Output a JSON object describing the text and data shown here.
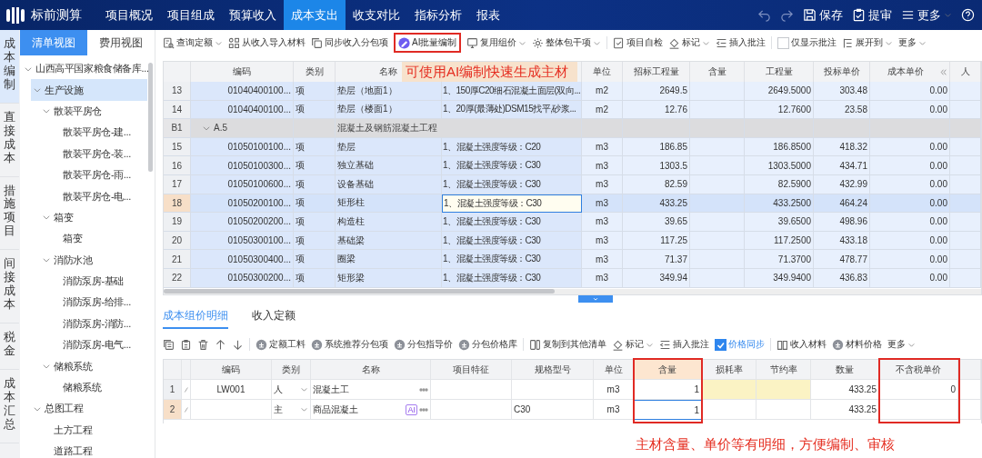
{
  "app": {
    "title": "标前测算"
  },
  "nav": {
    "tabs": [
      {
        "label": "项目概况",
        "selected": false
      },
      {
        "label": "项目组成",
        "selected": false
      },
      {
        "label": "预算收入",
        "selected": false
      },
      {
        "label": "成本支出",
        "selected": true
      },
      {
        "label": "收支对比",
        "selected": false
      },
      {
        "label": "指标分析",
        "selected": false
      },
      {
        "label": "报表",
        "selected": false
      }
    ],
    "actions": [
      {
        "label": "保存"
      },
      {
        "label": "提审"
      },
      {
        "label": "更多"
      }
    ]
  },
  "side_tabs": [
    {
      "label": "成本编制",
      "selected": true
    },
    {
      "label": "直接成本",
      "selected": false
    },
    {
      "label": "措施项目",
      "selected": false
    },
    {
      "label": "间接成本",
      "selected": false
    },
    {
      "label": "税金",
      "selected": false
    },
    {
      "label": "成本汇总",
      "selected": false
    }
  ],
  "view_tabs": [
    {
      "label": "清单视图",
      "selected": true
    },
    {
      "label": "费用视图",
      "selected": false
    }
  ],
  "tree": {
    "items": [
      {
        "label": "山西高平国家粮食储备库...",
        "selected": false,
        "expanded": true,
        "children": [
          {
            "label": "生产设施",
            "selected": true,
            "expanded": true,
            "children": [
              {
                "label": "散装平房仓",
                "selected": false,
                "expanded": true,
                "children": [
                  {
                    "label": "散装平房仓-建...",
                    "selected": false
                  },
                  {
                    "label": "散装平房仓-装...",
                    "selected": false
                  },
                  {
                    "label": "散装平房仓-雨...",
                    "selected": false
                  },
                  {
                    "label": "散装平房仓-电...",
                    "selected": false
                  }
                ]
              },
              {
                "label": "箱变",
                "selected": false,
                "expanded": true,
                "children": [
                  {
                    "label": "箱变",
                    "selected": false
                  }
                ]
              },
              {
                "label": "消防水池",
                "selected": false,
                "expanded": true,
                "children": [
                  {
                    "label": "消防泵房-基础",
                    "selected": false
                  },
                  {
                    "label": "消防泵房-给排...",
                    "selected": false
                  },
                  {
                    "label": "消防泵房-消防...",
                    "selected": false
                  },
                  {
                    "label": "消防泵房-电气...",
                    "selected": false
                  }
                ]
              },
              {
                "label": "储粮系统",
                "selected": false,
                "expanded": true,
                "children": [
                  {
                    "label": "储粮系统",
                    "selected": false
                  }
                ]
              }
            ]
          },
          {
            "label": "总图工程",
            "selected": false,
            "expanded": true,
            "children": [
              {
                "label": "土方工程",
                "selected": false
              },
              {
                "label": "道路工程",
                "selected": false
              }
            ]
          }
        ]
      }
    ]
  },
  "toolbar": {
    "groups": [
      [
        {
          "label": "查询定额",
          "kind": "dropdown"
        },
        {
          "label": "从收入导入材料",
          "kind": "button"
        },
        {
          "label": "同步收入分包项",
          "kind": "button"
        },
        {
          "label": "AI批量编制",
          "kind": "button"
        },
        {
          "label": "复用组价",
          "kind": "dropdown"
        },
        {
          "label": "整体包干项",
          "kind": "dropdown"
        }
      ],
      [
        {
          "label": "项目自检",
          "kind": "button"
        },
        {
          "label": "标记",
          "kind": "dropdown"
        },
        {
          "label": "插入批注",
          "kind": "button"
        }
      ],
      [
        {
          "label": "仅显示批注",
          "kind": "checkbox",
          "checked": false
        },
        {
          "label": "展开到",
          "kind": "dropdown"
        },
        {
          "label": "更多",
          "kind": "dropdown"
        }
      ]
    ]
  },
  "grid": {
    "columns": [
      {
        "label": "编码"
      },
      {
        "label": "类别"
      },
      {
        "label": "名称"
      },
      {},
      {
        "label": "单位"
      },
      {
        "label": "招标工程量"
      },
      {
        "label": "含量"
      },
      {
        "label": "工程量"
      },
      {
        "label": "投标单价"
      },
      {
        "label": "成本单价"
      },
      {
        "label": "人"
      }
    ],
    "annotation": "可使用AI编制快速生成主材",
    "rows": [
      {
        "kind": "item",
        "num": "13",
        "code": "01040400100...",
        "type": "项",
        "name": "垫层（地面1）",
        "feature": "1、150厚C20细石混凝土面层(双向...",
        "unit": "m2",
        "bid_qty": "2649.5",
        "qty": "2649.5000",
        "bid_price": "303.48",
        "cost_price": "0.00",
        "selected": false
      },
      {
        "kind": "item",
        "num": "14",
        "code": "01040400100...",
        "type": "项",
        "name": "垫层（楼面1）",
        "feature": "1、20厚(最薄处)DSM15找平,砂浆...",
        "unit": "m2",
        "bid_qty": "12.76",
        "qty": "12.7600",
        "bid_price": "23.58",
        "cost_price": "0.00",
        "selected": false
      },
      {
        "kind": "group",
        "num": "B1",
        "code": "A.5",
        "name": "混凝土及钢筋混凝土工程",
        "expanded": true
      },
      {
        "kind": "item",
        "num": "15",
        "code": "01050100100...",
        "type": "项",
        "name": "垫层",
        "feature": "1、混凝土强度等级：C20",
        "unit": "m3",
        "bid_qty": "186.85",
        "qty": "186.8500",
        "bid_price": "418.32",
        "cost_price": "0.00",
        "selected": false
      },
      {
        "kind": "item",
        "num": "16",
        "code": "01050100300...",
        "type": "项",
        "name": "独立基础",
        "feature": "1、混凝土强度等级：C30",
        "unit": "m3",
        "bid_qty": "1303.5",
        "qty": "1303.5000",
        "bid_price": "434.71",
        "cost_price": "0.00",
        "selected": false
      },
      {
        "kind": "item",
        "num": "17",
        "code": "01050100600...",
        "type": "项",
        "name": "设备基础",
        "feature": "1、混凝土强度等级：C30",
        "unit": "m3",
        "bid_qty": "82.59",
        "qty": "82.5900",
        "bid_price": "432.99",
        "cost_price": "0.00",
        "selected": false
      },
      {
        "kind": "item",
        "num": "18",
        "code": "01050200100...",
        "type": "项",
        "name": "矩形柱",
        "feature": "1、混凝土强度等级：C30",
        "unit": "m3",
        "bid_qty": "433.25",
        "qty": "433.2500",
        "bid_price": "464.24",
        "cost_price": "0.00",
        "selected": true
      },
      {
        "kind": "item",
        "num": "19",
        "code": "01050200200...",
        "type": "项",
        "name": "构造柱",
        "feature": "1、混凝土强度等级：C30",
        "unit": "m3",
        "bid_qty": "39.65",
        "qty": "39.6500",
        "bid_price": "498.96",
        "cost_price": "0.00",
        "selected": false
      },
      {
        "kind": "item",
        "num": "20",
        "code": "01050300100...",
        "type": "项",
        "name": "基础梁",
        "feature": "1、混凝土强度等级：C30",
        "unit": "m3",
        "bid_qty": "117.25",
        "qty": "117.2500",
        "bid_price": "433.18",
        "cost_price": "0.00",
        "selected": false
      },
      {
        "kind": "item",
        "num": "21",
        "code": "01050300400...",
        "type": "项",
        "name": "圈梁",
        "feature": "1、混凝土强度等级：C30",
        "unit": "m3",
        "bid_qty": "71.37",
        "qty": "71.3700",
        "bid_price": "478.77",
        "cost_price": "0.00",
        "selected": false
      },
      {
        "kind": "item",
        "num": "22",
        "code": "01050300200...",
        "type": "项",
        "name": "矩形梁",
        "feature": "1、混凝土强度等级：C30",
        "unit": "m3",
        "bid_qty": "349.94",
        "qty": "349.9400",
        "bid_price": "436.83",
        "cost_price": "0.00",
        "selected": false
      }
    ]
  },
  "detail_tabs": [
    {
      "label": "成本组价明细",
      "selected": true
    },
    {
      "label": "收入定额",
      "selected": false
    }
  ],
  "detail_toolbar": {
    "groups": [
      [
        {
          "label": "定额工料",
          "kind": "button"
        },
        {
          "label": "系统推荐分包项",
          "kind": "button"
        },
        {
          "label": "分包指导价",
          "kind": "button"
        },
        {
          "label": "分包价格库",
          "kind": "button"
        }
      ],
      [
        {
          "label": "复制到其他清单",
          "kind": "button"
        },
        {
          "label": "标记",
          "kind": "dropdown"
        },
        {
          "label": "插入批注",
          "kind": "button"
        },
        {
          "label": "价格同步",
          "kind": "checkbox",
          "checked": true
        }
      ],
      [
        {
          "label": "收入材料",
          "kind": "button"
        },
        {
          "label": "材料价格",
          "kind": "button"
        },
        {
          "label": "更多",
          "kind": "dropdown"
        }
      ]
    ]
  },
  "detail": {
    "columns": [
      {
        "label": "编码"
      },
      {
        "label": "类别"
      },
      {
        "label": "名称"
      },
      {
        "label": "项目特征"
      },
      {
        "label": "规格型号"
      },
      {
        "label": "单位"
      },
      {
        "label": "含量"
      },
      {
        "label": "损耗率"
      },
      {
        "label": "节约率"
      },
      {
        "label": "数量"
      },
      {
        "label": "不含税单价"
      }
    ],
    "annotation": "主材含量、单价等有明细，方便编制、审核",
    "rows": [
      {
        "num": "1",
        "code": "LW001",
        "type": "人",
        "name": "混凝土工",
        "unit": "m3",
        "content": "1",
        "qty": "433.25",
        "price": "0",
        "rates_editable": true,
        "selected": false
      },
      {
        "num": "2",
        "type": "主",
        "name": "商品混凝土",
        "badge": "AI",
        "spec": "C30",
        "unit": "m3",
        "content": "1",
        "qty": "433.25",
        "rates_editable": false,
        "selected": true
      }
    ]
  }
}
